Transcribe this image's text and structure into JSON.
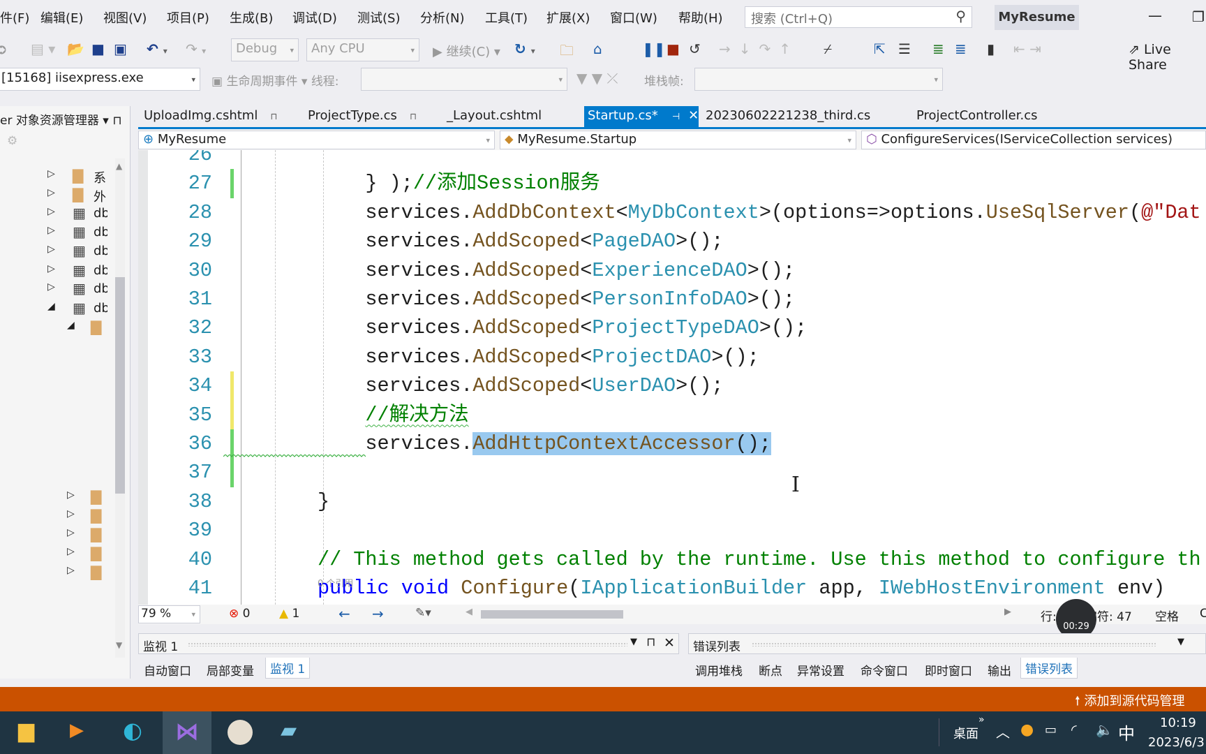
{
  "menu": [
    "件(F)",
    "编辑(E)",
    "视图(V)",
    "项目(P)",
    "生成(B)",
    "调试(D)",
    "测试(S)",
    "分析(N)",
    "工具(T)",
    "扩展(X)",
    "窗口(W)",
    "帮助(H)"
  ],
  "search": {
    "placeholder": "搜索 (Ctrl+Q)",
    "icon": "search-icon"
  },
  "solution_name": "MyResume",
  "toolbar": {
    "config": "Debug",
    "platform": "Any CPU",
    "continue": "继续(C)",
    "live_share": "Live Share"
  },
  "debug_bar": {
    "process": "[15168] iisexpress.exe",
    "lifecycle": "生命周期事件",
    "thread_label": "线程:",
    "stack_label": "堆栈帧:"
  },
  "left_panel": {
    "title": "er 对象资源管理器",
    "items": [
      "系",
      "外",
      "db",
      "db",
      "db",
      "db",
      "db",
      "db"
    ]
  },
  "tabs": [
    {
      "label": "UploadImg.cshtml",
      "pinned": true
    },
    {
      "label": "ProjectType.cs",
      "pinned": true
    },
    {
      "label": "_Layout.cshtml"
    },
    {
      "label": "Startup.cs*",
      "active": true
    },
    {
      "label": "20230602221238_third.cs"
    },
    {
      "label": "ProjectController.cs"
    }
  ],
  "navbar": {
    "project": "MyResume",
    "class": "MyResume.Startup",
    "member": "ConfigureServices(IServiceCollection services)"
  },
  "code": [
    {
      "n": "26",
      "indent": 4,
      "tokens": []
    },
    {
      "n": "27",
      "indent": 4,
      "mark": "green",
      "tokens": [
        [
          "p",
          "} );"
        ],
        [
          "c",
          "//添加Session服务"
        ]
      ]
    },
    {
      "n": "28",
      "indent": 4,
      "tokens": [
        [
          "p",
          "services."
        ],
        [
          "m",
          "AddDbContext"
        ],
        [
          "p",
          "<"
        ],
        [
          "t",
          "MyDbContext"
        ],
        [
          "p",
          ">(options=>options."
        ],
        [
          "m",
          "UseSqlServer"
        ],
        [
          "p",
          "("
        ],
        [
          "s",
          "@\"Dat"
        ]
      ]
    },
    {
      "n": "29",
      "indent": 4,
      "tokens": [
        [
          "p",
          "services."
        ],
        [
          "m",
          "AddScoped"
        ],
        [
          "p",
          "<"
        ],
        [
          "t",
          "PageDAO"
        ],
        [
          "p",
          ">();"
        ]
      ]
    },
    {
      "n": "30",
      "indent": 4,
      "tokens": [
        [
          "p",
          "services."
        ],
        [
          "m",
          "AddScoped"
        ],
        [
          "p",
          "<"
        ],
        [
          "t",
          "ExperienceDAO"
        ],
        [
          "p",
          ">();"
        ]
      ]
    },
    {
      "n": "31",
      "indent": 4,
      "tokens": [
        [
          "p",
          "services."
        ],
        [
          "m",
          "AddScoped"
        ],
        [
          "p",
          "<"
        ],
        [
          "t",
          "PersonInfoDAO"
        ],
        [
          "p",
          ">();"
        ]
      ]
    },
    {
      "n": "32",
      "indent": 4,
      "tokens": [
        [
          "p",
          "services."
        ],
        [
          "m",
          "AddScoped"
        ],
        [
          "p",
          "<"
        ],
        [
          "t",
          "ProjectTypeDAO"
        ],
        [
          "p",
          ">();"
        ]
      ]
    },
    {
      "n": "33",
      "indent": 4,
      "tokens": [
        [
          "p",
          "services."
        ],
        [
          "m",
          "AddScoped"
        ],
        [
          "p",
          "<"
        ],
        [
          "t",
          "ProjectDAO"
        ],
        [
          "p",
          ">();"
        ]
      ]
    },
    {
      "n": "34",
      "indent": 4,
      "mark": "yellow",
      "tokens": [
        [
          "p",
          "services."
        ],
        [
          "m",
          "AddScoped"
        ],
        [
          "p",
          "<"
        ],
        [
          "t",
          "UserDAO"
        ],
        [
          "p",
          ">();"
        ]
      ]
    },
    {
      "n": "35",
      "indent": 4,
      "mark": "yellow",
      "tokens": [
        [
          "c sq",
          "//解决方法"
        ]
      ]
    },
    {
      "n": "36",
      "indent": 4,
      "mark": "green",
      "tokens": [
        [
          "p",
          "services."
        ],
        [
          "m t-sel",
          "AddHttpContextAccessor"
        ],
        [
          "p t-sel",
          "();"
        ]
      ]
    },
    {
      "n": "37",
      "indent": 4,
      "mark": "green",
      "tokens": []
    },
    {
      "n": "38",
      "indent": 0,
      "tokens": [
        [
          "p",
          "}"
        ]
      ]
    },
    {
      "n": "39",
      "indent": 0,
      "tokens": []
    },
    {
      "n": "40",
      "indent": 0,
      "tokens": [
        [
          "c",
          "// This method gets called by the runtime. Use this method to configure th"
        ]
      ]
    },
    {
      "n": "41",
      "indent": 0,
      "tokens": [
        [
          "k",
          "public"
        ],
        [
          "p",
          " "
        ],
        [
          "k",
          "void"
        ],
        [
          "p",
          " "
        ],
        [
          "m",
          "Configure"
        ],
        [
          "p",
          "("
        ],
        [
          "t",
          "IApplicationBuilder"
        ],
        [
          "p",
          " app, "
        ],
        [
          "t",
          "IWebHostEnvironment"
        ],
        [
          "p",
          " env)"
        ]
      ]
    }
  ],
  "codelens": "0 个引用",
  "status": {
    "zoom": "79 %",
    "errors": "0",
    "warnings": "1",
    "line": "行: 36",
    "char": "字符: 47",
    "spaces": "空格",
    "crlf": "C"
  },
  "recording": "00:29",
  "watch_panel": {
    "title": "监视 1"
  },
  "error_panel": {
    "title": "错误列表"
  },
  "bottom_tabs_left": [
    "自动窗口",
    "局部变量",
    "监视 1"
  ],
  "bottom_tabs_right": [
    "调用堆栈",
    "断点",
    "异常设置",
    "命令窗口",
    "即时窗口",
    "输出",
    "错误列表"
  ],
  "source_control": "添加到源代码管理",
  "taskbar": {
    "desktop": "桌面",
    "ime": "中",
    "time": "10:19",
    "date": "2023/6/3"
  },
  "colors": {
    "accent": "#007acc",
    "status_bar": "#ca5100",
    "taskbar": "#1f3442",
    "selection": "#99c9ef"
  }
}
